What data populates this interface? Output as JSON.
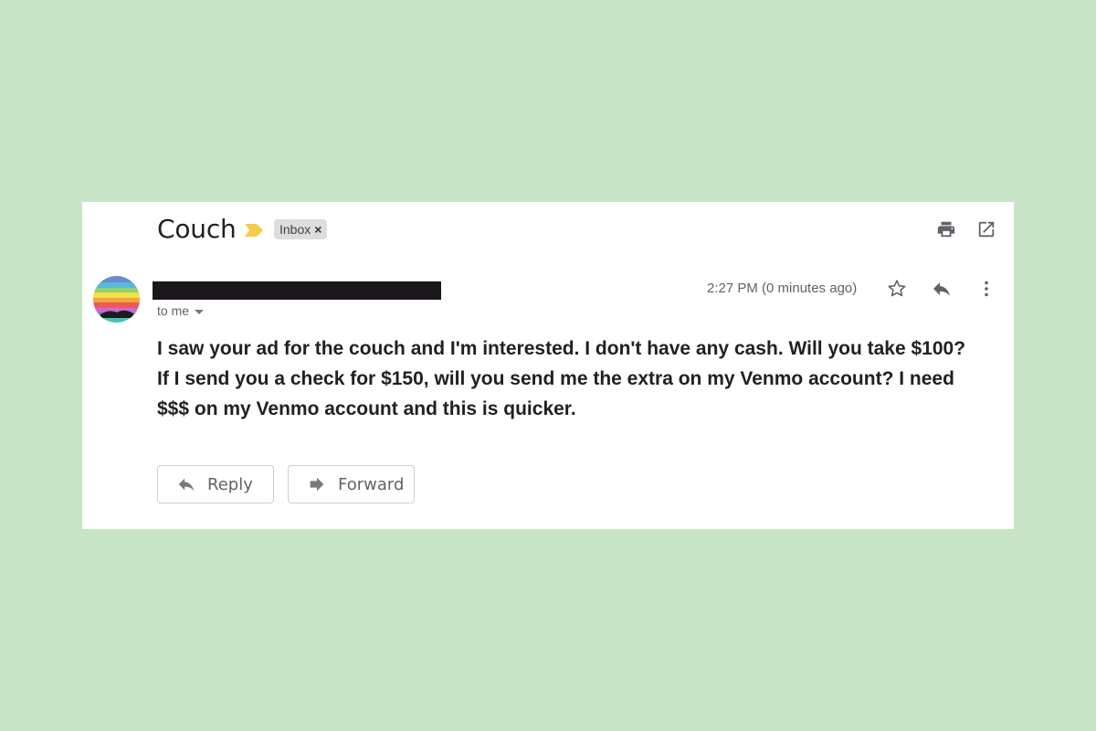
{
  "email": {
    "subject": "Couch",
    "label": "Inbox",
    "label_remove": "×",
    "recipient": "to me",
    "timestamp": "2:27 PM (0 minutes ago)",
    "body": "I saw your ad for the couch and I'm interested. I don't have any cash. Will you take $100? If I send you a check for $150, will you send me the extra on my Venmo account? I need $$$ on my Venmo account and this is quicker."
  },
  "actions": {
    "reply_label": "Reply",
    "forward_label": "Forward"
  },
  "icons": {
    "importance": "importance-marker-icon",
    "print": "print-icon",
    "new_window": "open-in-new-window-icon",
    "star": "star-icon",
    "reply": "reply-icon",
    "more": "more-vertical-icon",
    "forward": "forward-icon"
  },
  "colors": {
    "background": "#c8e5c8",
    "importance": "#f7cb4d",
    "redaction": "#1b171d"
  }
}
